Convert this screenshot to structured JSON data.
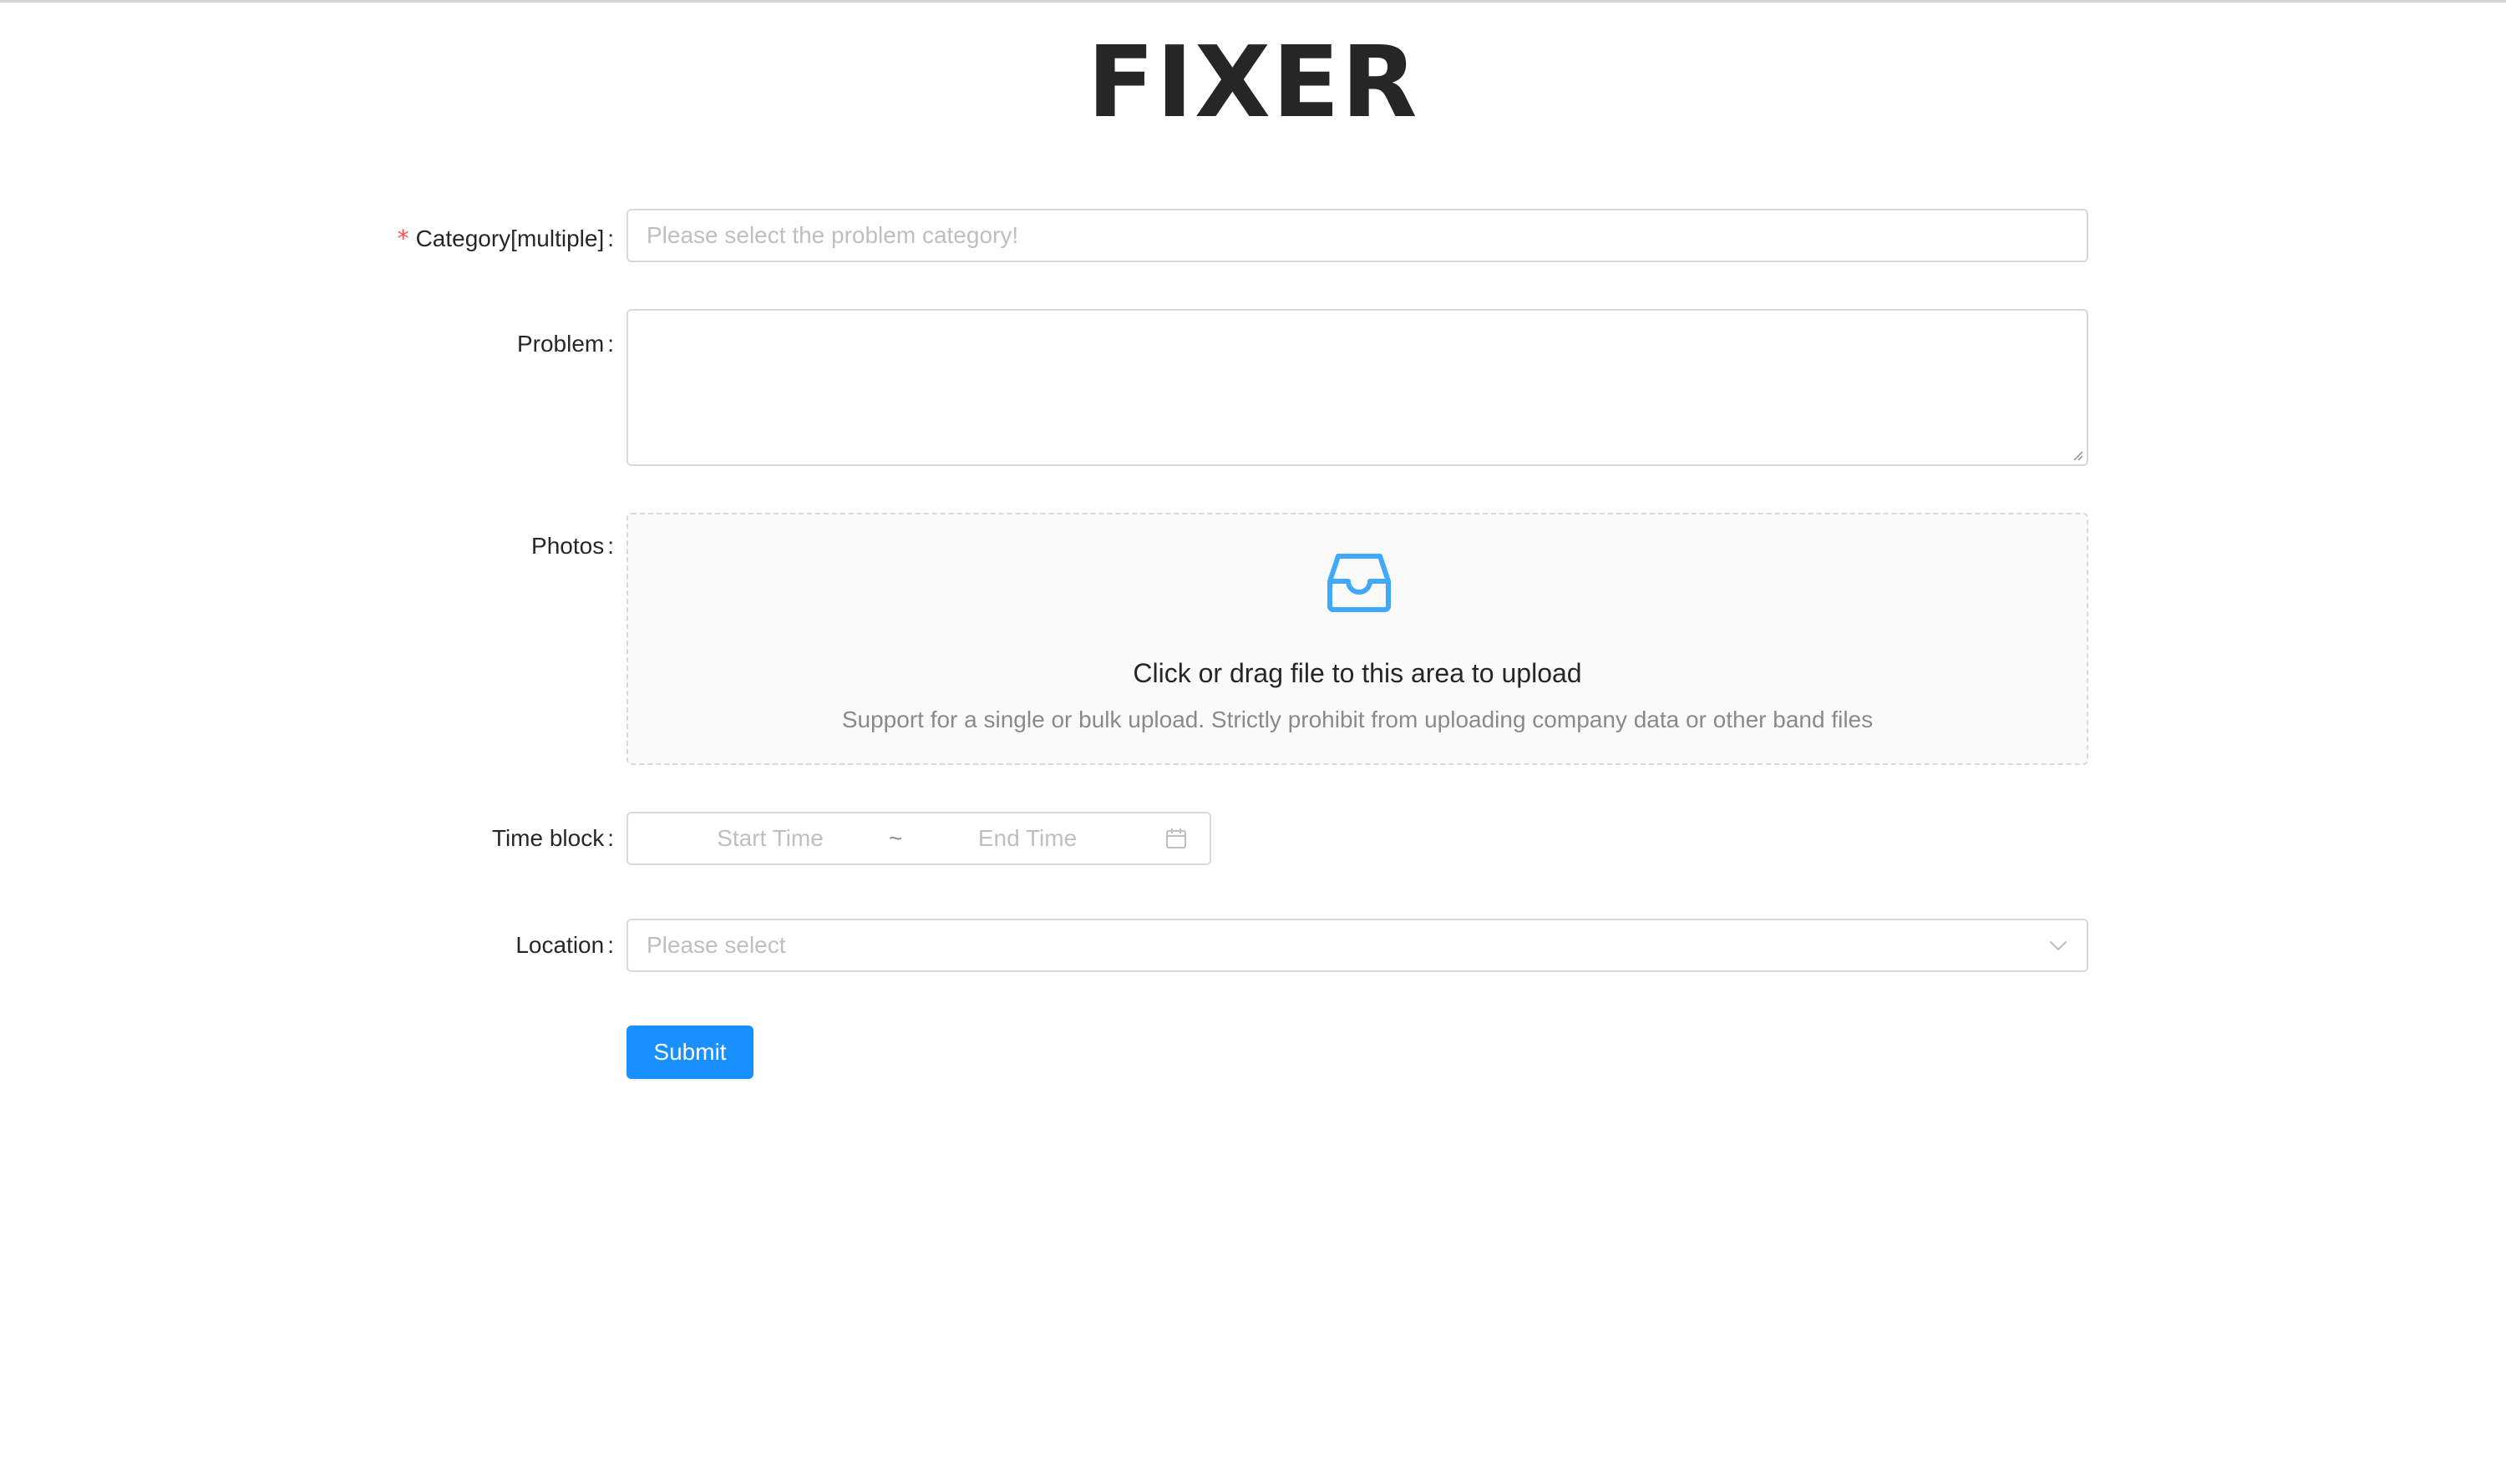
{
  "app": {
    "title": "FIXER"
  },
  "form": {
    "category": {
      "label": "Category[multiple]",
      "required_mark": "*",
      "placeholder": "Please select the problem category!",
      "value": ""
    },
    "problem": {
      "label": "Problem",
      "value": ""
    },
    "photos": {
      "label": "Photos",
      "icon": "inbox-icon",
      "upload_text": "Click or drag file to this area to upload",
      "upload_hint": "Support for a single or bulk upload. Strictly prohibit from uploading company data or other band files"
    },
    "time_block": {
      "label": "Time block",
      "start_placeholder": "Start Time",
      "separator": "~",
      "end_placeholder": "End Time",
      "icon": "calendar-icon"
    },
    "location": {
      "label": "Location",
      "placeholder": "Please select",
      "icon": "chevron-down-icon"
    },
    "colon": ":",
    "submit_label": "Submit"
  },
  "colors": {
    "primary": "#1890ff",
    "required": "#ff4d4f",
    "border": "#d9d9d9",
    "placeholder": "#bfbfbf",
    "dropzone_bg": "#fafafa"
  }
}
